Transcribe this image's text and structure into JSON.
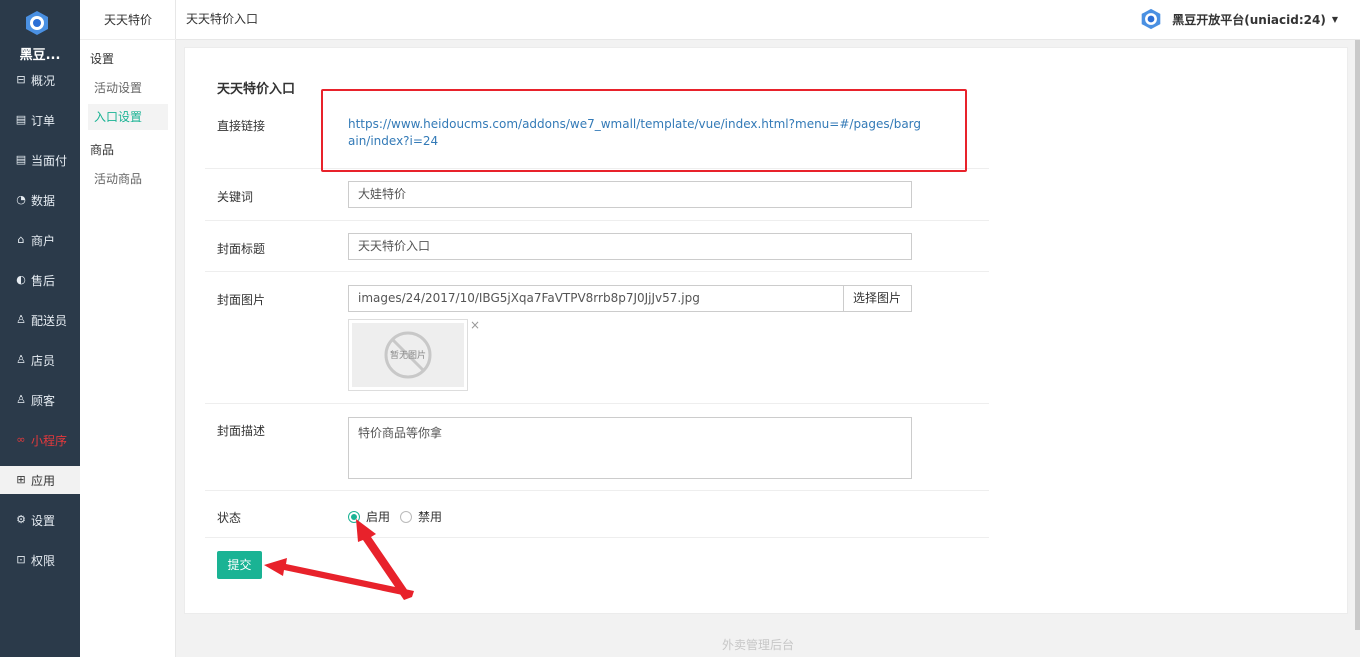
{
  "brand": {
    "name": "黑豆..."
  },
  "nav": [
    {
      "label": "概况",
      "icon": "overview-icon",
      "glyph": "⊟"
    },
    {
      "label": "订单",
      "icon": "order-icon",
      "glyph": "▤"
    },
    {
      "label": "当面付",
      "icon": "face-pay-icon",
      "glyph": "▤"
    },
    {
      "label": "数据",
      "icon": "data-icon",
      "glyph": "◔"
    },
    {
      "label": "商户",
      "icon": "store-icon",
      "glyph": "⌂"
    },
    {
      "label": "售后",
      "icon": "aftersale-icon",
      "glyph": "◐"
    },
    {
      "label": "配送员",
      "icon": "courier-icon",
      "glyph": "♙"
    },
    {
      "label": "店员",
      "icon": "clerk-icon",
      "glyph": "♙"
    },
    {
      "label": "顾客",
      "icon": "customer-icon",
      "glyph": "♙"
    },
    {
      "label": "小程序",
      "icon": "miniprogram-icon",
      "glyph": "∞"
    },
    {
      "label": "应用",
      "icon": "apps-icon",
      "glyph": "⊞"
    },
    {
      "label": "设置",
      "icon": "settings-icon",
      "glyph": "⚙"
    },
    {
      "label": "权限",
      "icon": "lock-icon",
      "glyph": "⊡"
    }
  ],
  "subnav": {
    "title": "天天特价",
    "group1": "设置",
    "item1": "活动设置",
    "item2": "入口设置",
    "group2": "商品",
    "item3": "活动商品"
  },
  "topbar": {
    "title": "天天特价入口",
    "account": "黑豆开放平台(uniacid:24)"
  },
  "form": {
    "title": "天天特价入口",
    "link_label": "直接链接",
    "link_url": "https://www.heidoucms.com/addons/we7_wmall/template/vue/index.html?menu=#/pages/bargain/index?i=24",
    "keyword_label": "关键词",
    "keyword_value": "大娃特价",
    "cover_title_label": "封面标题",
    "cover_title_value": "天天特价入口",
    "cover_image_label": "封面图片",
    "cover_image_value": "images/24/2017/10/IBG5jXqa7FaVTPV8rrb8p7J0JjJv57.jpg",
    "choose_image": "选择图片",
    "no_image": "暂无图片",
    "remove": "×",
    "cover_desc_label": "封面描述",
    "cover_desc_value": "特价商品等你拿",
    "status_label": "状态",
    "status_on": "启用",
    "status_off": "禁用",
    "submit": "提交"
  },
  "footer": "外卖管理后台",
  "colors": {
    "accent": "#1ab394",
    "sidebar": "#2b3a4a",
    "annotation": "#e8222b"
  }
}
